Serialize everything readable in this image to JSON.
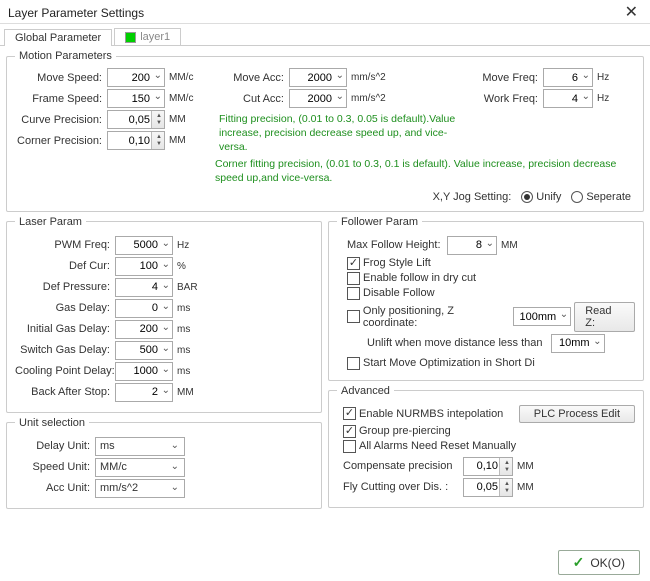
{
  "window": {
    "title": "Layer Parameter Settings",
    "close_glyph": "✕"
  },
  "tabs": [
    "Global Parameter",
    "layer1"
  ],
  "motion": {
    "legend": "Motion Parameters",
    "move_speed": {
      "label": "Move Speed:",
      "value": "200",
      "unit": "MM/c"
    },
    "frame_speed": {
      "label": "Frame Speed:",
      "value": "150",
      "unit": "MM/c"
    },
    "curve_precision": {
      "label": "Curve Precision:",
      "value": "0,05",
      "unit": "MM"
    },
    "corner_precision": {
      "label": "Corner Precision:",
      "value": "0,10",
      "unit": "MM"
    },
    "move_acc": {
      "label": "Move Acc:",
      "value": "2000",
      "unit": "mm/s^2"
    },
    "cut_acc": {
      "label": "Cut Acc:",
      "value": "2000",
      "unit": "mm/s^2"
    },
    "move_freq": {
      "label": "Move Freq:",
      "value": "6",
      "unit": "Hz"
    },
    "work_freq": {
      "label": "Work Freq:",
      "value": "4",
      "unit": "Hz"
    },
    "hint1": "Fitting precision, (0.01 to 0.3, 0.05 is default).Value increase, precision decrease speed up, and vice-versa.",
    "hint2": "Corner fitting precision, (0.01 to 0.3, 0.1 is default). Value increase, precision decrease speed up,and vice-versa.",
    "jog_label": "X,Y Jog Setting:",
    "jog_unify": "Unify",
    "jog_separate": "Seperate"
  },
  "laser": {
    "legend": "Laser Param",
    "pwm_freq": {
      "label": "PWM Freq:",
      "value": "5000",
      "unit": "Hz"
    },
    "def_cur": {
      "label": "Def Cur:",
      "value": "100",
      "unit": "%"
    },
    "def_pressure": {
      "label": "Def Pressure:",
      "value": "4",
      "unit": "BAR"
    },
    "gas_delay": {
      "label": "Gas Delay:",
      "value": "0",
      "unit": "ms"
    },
    "initial_gas_delay": {
      "label": "Initial Gas Delay:",
      "value": "200",
      "unit": "ms"
    },
    "switch_gas_delay": {
      "label": "Switch Gas Delay:",
      "value": "500",
      "unit": "ms"
    },
    "cooling_point_delay": {
      "label": "Cooling Point Delay:",
      "value": "1000",
      "unit": "ms"
    },
    "back_after_stop": {
      "label": "Back After Stop:",
      "value": "2",
      "unit": "MM"
    }
  },
  "follower": {
    "legend": "Follower Param",
    "max_follow_height": {
      "label": "Max Follow Height:",
      "value": "8",
      "unit": "MM"
    },
    "frog_style_lift": {
      "label": "Frog Style Lift",
      "checked": true
    },
    "enable_follow_dry": {
      "label": "Enable follow in dry cut",
      "checked": false
    },
    "disable_follow": {
      "label": "Disable Follow",
      "checked": false
    },
    "only_positioning": {
      "label": "Only positioning, Z coordinate:",
      "checked": false,
      "value": "100mm"
    },
    "read_z": "Read Z:",
    "unlift_label": "Unlift when move distance less than",
    "unlift_value": "10mm",
    "start_move_opt": {
      "label": "Start Move Optimization in Short Di",
      "checked": false
    }
  },
  "units": {
    "legend": "Unit selection",
    "delay_unit": {
      "label": "Delay Unit:",
      "value": "ms"
    },
    "speed_unit": {
      "label": "Speed Unit:",
      "value": "MM/c"
    },
    "acc_unit": {
      "label": "Acc Unit:",
      "value": "mm/s^2"
    }
  },
  "advanced": {
    "legend": "Advanced",
    "enable_nurmbs": {
      "label": "Enable NURMBS intepolation",
      "checked": true
    },
    "group_prepierce": {
      "label": "Group pre-piercing",
      "checked": true
    },
    "all_alarms_reset": {
      "label": "All Alarms Need Reset Manually",
      "checked": false
    },
    "plc_button": "PLC Process Edit",
    "compensate_precision": {
      "label": "Compensate precision",
      "value": "0,10",
      "unit": "MM"
    },
    "fly_cutting_over": {
      "label": "Fly Cutting over Dis. :",
      "value": "0,05",
      "unit": "MM"
    }
  },
  "footer": {
    "ok": "OK(O)"
  }
}
